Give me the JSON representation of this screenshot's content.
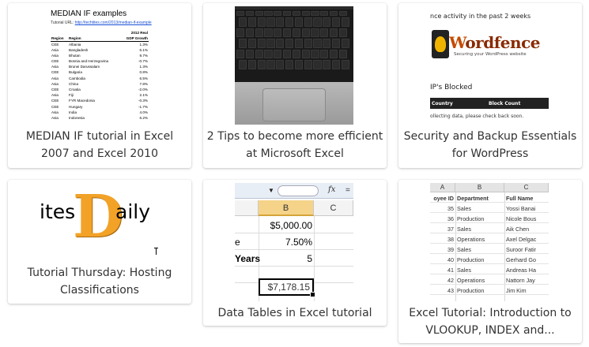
{
  "cards": [
    {
      "caption": "MEDIAN IF tutorial in Excel 2007 and Excel 2010",
      "thumb": {
        "title": "MEDIAN IF examples",
        "url_label": "Tutorial URL:",
        "url": "http://techtites.com/2013/median-if-example",
        "col_header_top": "2012 Real",
        "headers": [
          "Region",
          "Region",
          "GDP Growth"
        ],
        "rows": [
          [
            "CEE",
            "Albania",
            "1.3%"
          ],
          [
            "Asia",
            "Bangladesh",
            "6.1%"
          ],
          [
            "Asia",
            "Bhutan",
            "9.7%"
          ],
          [
            "CEE",
            "Bosnia and Herzegovina",
            "-0.7%"
          ],
          [
            "Asia",
            "Brunei Darussalam",
            "1.3%"
          ],
          [
            "CEE",
            "Bulgaria",
            "0.8%"
          ],
          [
            "Asia",
            "Cambodia",
            "6.5%"
          ],
          [
            "Asia",
            "China",
            "7.8%"
          ],
          [
            "CEE",
            "Croatia",
            "-2.0%"
          ],
          [
            "Asia",
            "Fiji",
            "2.1%"
          ],
          [
            "CEE",
            "FYR Macedonia",
            "-0.3%"
          ],
          [
            "CEE",
            "Hungary",
            "-1.7%"
          ],
          [
            "Asia",
            "India",
            "4.0%"
          ],
          [
            "Asia",
            "Indonesia",
            "6.2%"
          ]
        ]
      }
    },
    {
      "caption": "2 Tips to become more efficient at Microsoft Excel"
    },
    {
      "caption": "Security and Backup Essentials for WordPress",
      "thumb": {
        "top_text": "nce activity in the past 2 weeks",
        "logo_word_lead": "W",
        "logo_word_rest": "ordfence",
        "logo_tagline": "Securing your WordPress website",
        "section": "IP's Blocked",
        "columns": [
          "Country",
          "Block Count"
        ],
        "note": "ollecting data, please check back soon."
      }
    },
    {
      "caption": "Tutorial Thursday: Hosting Classifications",
      "thumb": {
        "left_text": "ites",
        "big_letter": "D",
        "right_text": "aily"
      }
    },
    {
      "caption": "Data Tables in Excel tutorial",
      "thumb": {
        "dropdown": "▼",
        "fx": "fx",
        "eq": "=",
        "col_b": "B",
        "col_c": "C",
        "rows": [
          {
            "label": "",
            "value": "$5,000.00"
          },
          {
            "label": "e",
            "value": "7.50%"
          },
          {
            "label": "Years",
            "value": "5"
          },
          {
            "label": "",
            "value": ""
          }
        ],
        "selected_value": "$7,178.15"
      }
    },
    {
      "caption": "Excel Tutorial: Introduction to VLOOKUP, INDEX and...",
      "thumb": {
        "col_headers": [
          "A",
          "B",
          "C"
        ],
        "header_row": [
          "oyee ID",
          "Department",
          "Full Name"
        ],
        "rows": [
          [
            "35",
            "Sales",
            "Yossi Banai"
          ],
          [
            "36",
            "Production",
            "Nicole Bous"
          ],
          [
            "37",
            "Sales",
            "Aik Chen"
          ],
          [
            "38",
            "Operations",
            "Axel Delgac"
          ],
          [
            "39",
            "Sales",
            "Suroor Fatir"
          ],
          [
            "40",
            "Production",
            "Gerhard Go"
          ],
          [
            "41",
            "Sales",
            "Andreas Ha"
          ],
          [
            "42",
            "Operations",
            "Nattorn Jay"
          ],
          [
            "43",
            "Production",
            "Jim Kim"
          ]
        ]
      }
    }
  ]
}
